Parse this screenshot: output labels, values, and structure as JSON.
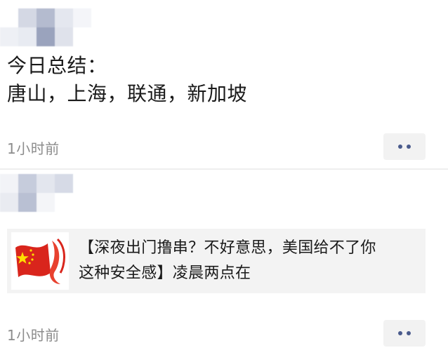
{
  "posts": [
    {
      "text_lines": [
        "今日总结：",
        "唐山，上海，联通，新加坡"
      ],
      "time": "1小时前",
      "more_icon": "more-dots-icon"
    },
    {
      "link_card": {
        "thumbnail_icon": "flag-thumbnail",
        "title_lines": [
          "【深夜出门撸串？不好意思，美国给不了你",
          "这种安全感】凌晨两点在"
        ]
      },
      "time": "1小时前",
      "more_icon": "more-dots-icon"
    }
  ],
  "colors": {
    "accent_dots": "#4a5b8c",
    "time_text": "#8c8c8c",
    "card_bg": "#f3f3f3",
    "flag_red": "#d9251c",
    "flag_star": "#ffde00"
  }
}
